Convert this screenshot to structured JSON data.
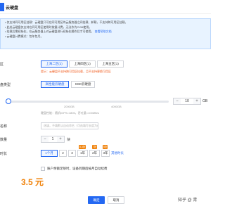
{
  "dialog": {
    "title": "云硬盘"
  },
  "notice": {
    "lines": [
      "• 仅支持同可用区挂载：云硬盘只可在同可用区的云服务器之间挂载、卸载，不支持跨可用区挂载。",
      "• 此处云硬盘仅支持在同可用区使用时按量计费，无法作为CVM使用。",
      "• 挂载后需初始化，在云服务器上对云硬盘进行初始化操作后才可使用。",
      "• 云硬盘计费模式：包年包月。"
    ],
    "link": "查看帮助文档"
  },
  "zone": {
    "label": "区",
    "options": [
      "上海二区(2)",
      "上海四区(1)",
      "上海五区(1)"
    ],
    "selected": 0,
    "warning": "提示：云硬盘不支持跨可用区挂载，且不支持更换可用区"
  },
  "disk_type": {
    "label": "盘类型",
    "options": [
      "高性能云硬盘",
      "SSD云硬盘"
    ],
    "selected": 0
  },
  "capacity": {
    "ticks": [
      "2000GB",
      "4000GB"
    ],
    "value": "10",
    "unit": "GB",
    "fraction": 0.01,
    "perf_text": "硬盘性能：随机IOPS=1800，吞吐量=100MB/s"
  },
  "name": {
    "label": "名称",
    "placeholder": "选填，不填默认自动命名（可选填写长度为60个字符以内）"
  },
  "quantity": {
    "label": "数量",
    "value": "1",
    "unit": "块"
  },
  "duration": {
    "label": "时长",
    "options": [
      "1个月",
      "2",
      "3",
      "1年",
      "2年",
      "3年"
    ],
    "selected": 0,
    "discounts": [
      {
        "index": 3,
        "text": "8.3折",
        "color": "#f0820a"
      },
      {
        "index": 4,
        "text": "7折",
        "color": "#f0820a"
      },
      {
        "index": 5,
        "text": "5折",
        "color": "#f0820a"
      }
    ],
    "more": "其他时长"
  },
  "auto_renew": {
    "label": "账户余额足够时，设备到期后按月自动续费"
  },
  "price": "3.5 元",
  "buttons": {
    "ok": "确定",
    "cancel": "取消"
  },
  "watermark": "知乎 @ 青"
}
